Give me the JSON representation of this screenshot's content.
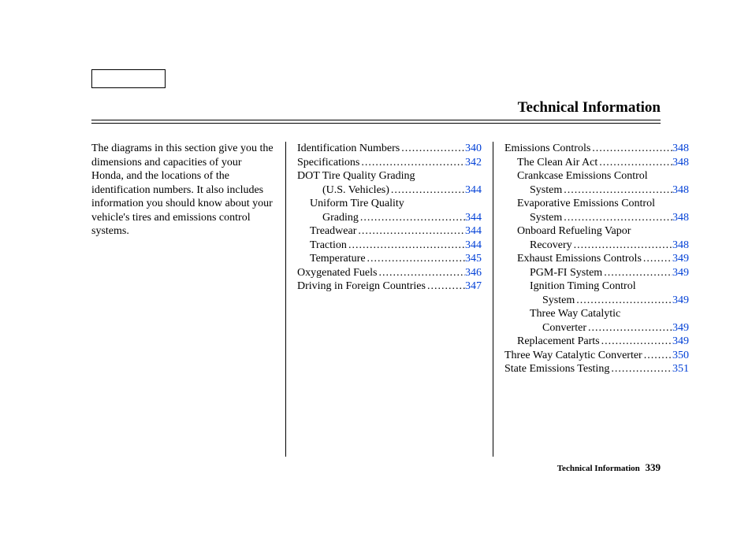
{
  "title": "Technical Information",
  "intro": "The diagrams in this section give you the dimensions and capacities of your Honda, and the locations of the identification numbers. It also includes information you should know about your vehicle's tires and emissions control systems.",
  "col2": [
    {
      "type": "entry",
      "indent": 0,
      "label": "Identification Numbers",
      "page": "340"
    },
    {
      "type": "entry",
      "indent": 0,
      "label": "Specifications",
      "page": "342"
    },
    {
      "type": "text",
      "indent": 0,
      "label": "DOT Tire Quality Grading"
    },
    {
      "type": "entry",
      "indent": 2,
      "label": "(U.S. Vehicles)",
      "page": "344"
    },
    {
      "type": "text",
      "indent": 1,
      "label": "Uniform Tire Quality"
    },
    {
      "type": "entry",
      "indent": 2,
      "label": "Grading",
      "page": "344"
    },
    {
      "type": "entry",
      "indent": 1,
      "label": "Treadwear",
      "page": "344"
    },
    {
      "type": "entry",
      "indent": 1,
      "label": "Traction",
      "page": "344"
    },
    {
      "type": "entry",
      "indent": 1,
      "label": "Temperature",
      "page": "345"
    },
    {
      "type": "entry",
      "indent": 0,
      "label": "Oxygenated Fuels",
      "page": "346"
    },
    {
      "type": "entry",
      "indent": 0,
      "label": "Driving in Foreign Countries",
      "page": "347"
    }
  ],
  "col3": [
    {
      "type": "entry",
      "indent": 0,
      "label": "Emissions Controls",
      "page": "348"
    },
    {
      "type": "entry",
      "indent": 1,
      "label": "The Clean Air Act",
      "page": "348"
    },
    {
      "type": "text",
      "indent": 1,
      "label": "Crankcase Emissions Control"
    },
    {
      "type": "entry",
      "indent": 2,
      "label": "System",
      "page": "348"
    },
    {
      "type": "text",
      "indent": 1,
      "label": "Evaporative Emissions Control"
    },
    {
      "type": "entry",
      "indent": 2,
      "label": "System",
      "page": "348"
    },
    {
      "type": "text",
      "indent": 1,
      "label": "Onboard Refueling Vapor"
    },
    {
      "type": "entry",
      "indent": 2,
      "label": "Recovery",
      "page": "348"
    },
    {
      "type": "entry",
      "indent": 1,
      "label": "Exhaust Emissions Controls",
      "page": "349"
    },
    {
      "type": "entry",
      "indent": 2,
      "label": "PGM-FI System",
      "page": "349"
    },
    {
      "type": "text",
      "indent": 2,
      "label": "Ignition Timing Control"
    },
    {
      "type": "entry",
      "indent": 3,
      "label": "System",
      "page": "349"
    },
    {
      "type": "text",
      "indent": 2,
      "label": "Three Way Catalytic"
    },
    {
      "type": "entry",
      "indent": 3,
      "label": "Converter",
      "page": "349"
    },
    {
      "type": "entry",
      "indent": 1,
      "label": "Replacement Parts",
      "page": "349"
    },
    {
      "type": "entry",
      "indent": 0,
      "label": "Three Way Catalytic Converter",
      "page": "350"
    },
    {
      "type": "entry",
      "indent": 0,
      "label": "State Emissions Testing",
      "page": "351"
    }
  ],
  "footer": {
    "section": "Technical Information",
    "page": "339"
  }
}
